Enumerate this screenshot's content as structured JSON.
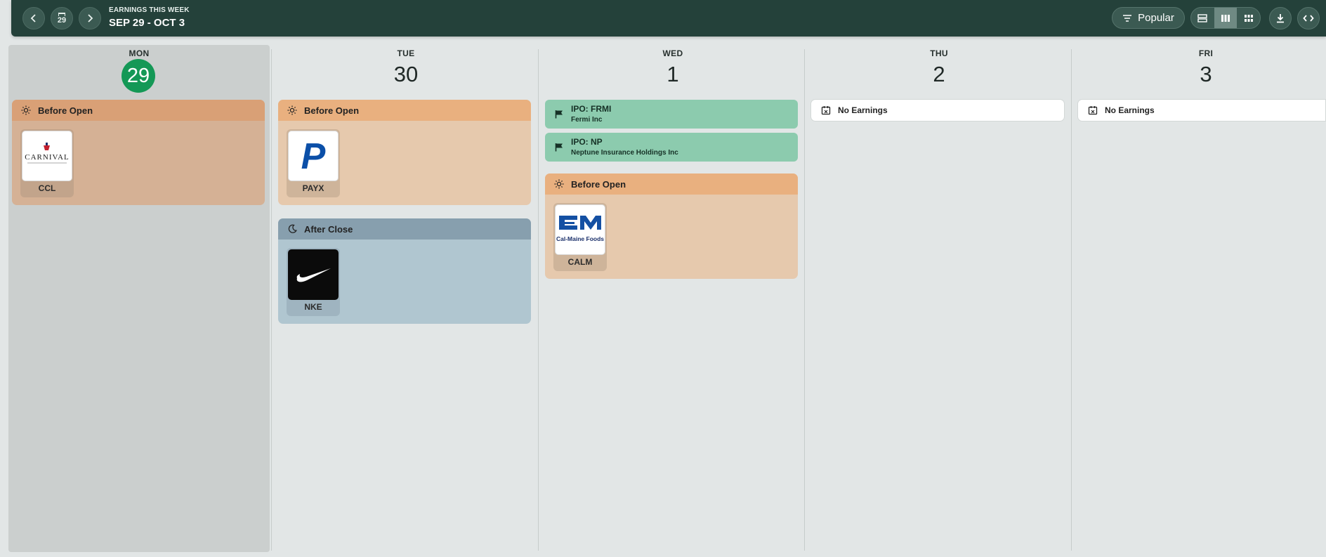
{
  "header": {
    "kicker": "EARNINGS THIS WEEK",
    "range": "SEP 29 - OCT 3",
    "today_button_num": "29",
    "popular_label": "Popular"
  },
  "days": [
    {
      "name": "MON",
      "num": "29"
    },
    {
      "name": "TUE",
      "num": "30"
    },
    {
      "name": "WED",
      "num": "1"
    },
    {
      "name": "THU",
      "num": "2"
    },
    {
      "name": "FRI",
      "num": "3"
    }
  ],
  "sections": {
    "before_open": "Before Open",
    "after_close": "After Close",
    "no_earnings": "No Earnings"
  },
  "mon": {
    "before": [
      {
        "ticker": "CCL",
        "logo_text": "CARNIVAL"
      }
    ]
  },
  "tue": {
    "before": [
      {
        "ticker": "PAYX",
        "logo_text": "P"
      }
    ],
    "after": [
      {
        "ticker": "NKE"
      }
    ]
  },
  "wed": {
    "ipos": [
      {
        "title": "IPO: FRMI",
        "company": "Fermi Inc"
      },
      {
        "title": "IPO: NP",
        "company": "Neptune Insurance Holdings Inc"
      }
    ],
    "before": [
      {
        "ticker": "CALM",
        "logo_text": "Cal-Maine Foods"
      }
    ]
  },
  "colors": {
    "topbar": "#24413a",
    "today_circle": "#149856",
    "before_open_header": "#e9b07f",
    "after_close_header": "#879fae",
    "ipo": "#8ccbae"
  }
}
